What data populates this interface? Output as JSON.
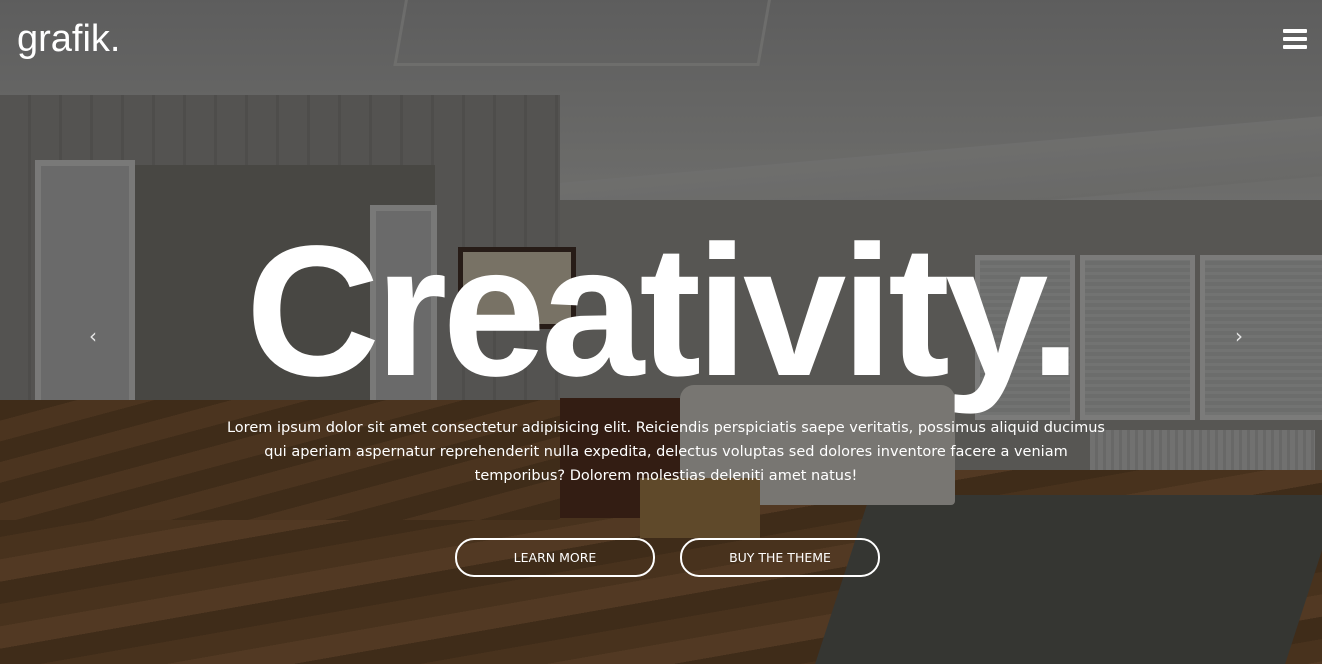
{
  "brand": {
    "logo_text": "grafik."
  },
  "nav": {
    "menu_icon": "hamburger-menu-icon"
  },
  "slider": {
    "prev_icon": "chevron-left-icon",
    "next_icon": "chevron-right-icon",
    "prev_glyph": "‹",
    "next_glyph": "›"
  },
  "hero": {
    "headline": "Creativity.",
    "description": "Lorem ipsum dolor sit amet consectetur adipisicing elit. Reiciendis perspiciatis saepe veritatis, possimus aliquid ducimus qui aperiam aspernatur reprehenderit nulla expedita, delectus voluptas sed dolores inventore facere a veniam temporibus? Dolorem molestias deleniti amet natus!",
    "buttons": [
      {
        "label": "LEARN MORE"
      },
      {
        "label": "BUY THE THEME"
      }
    ]
  },
  "colors": {
    "text": "#ffffff",
    "overlay": "rgba(0,0,0,0.32)"
  }
}
